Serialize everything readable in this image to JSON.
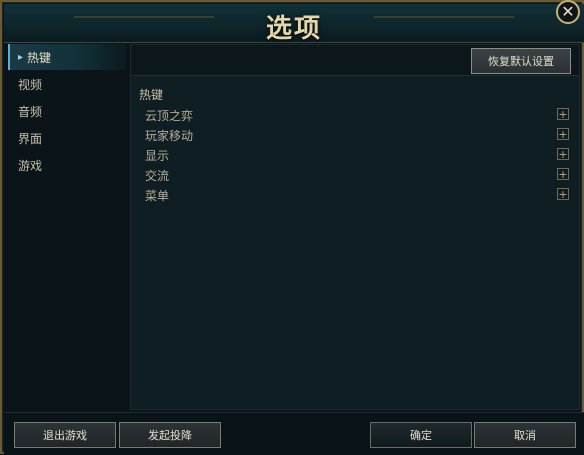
{
  "window": {
    "title": "选项",
    "close_glyph": "✕"
  },
  "sidebar": {
    "items": [
      {
        "label": "热键",
        "active": true
      },
      {
        "label": "视频",
        "active": false
      },
      {
        "label": "音频",
        "active": false
      },
      {
        "label": "界面",
        "active": false
      },
      {
        "label": "游戏",
        "active": false
      }
    ]
  },
  "main": {
    "reset_label": "恢复默认设置",
    "section_title": "热键",
    "rows": [
      {
        "label": "云顶之弈"
      },
      {
        "label": "玩家移动"
      },
      {
        "label": "显示"
      },
      {
        "label": "交流"
      },
      {
        "label": "菜单"
      }
    ],
    "expand_glyph": "+"
  },
  "footer": {
    "exit_label": "退出游戏",
    "surrender_label": "发起投降",
    "ok_label": "确定",
    "cancel_label": "取消"
  },
  "icons": {
    "close": "close-icon",
    "expand": "plus-icon",
    "active_marker": "caret-right-icon"
  },
  "colors": {
    "accent": "#5ab3cf",
    "gold": "#c7b27a",
    "title_text": "#e6d7a8",
    "panel_bg": "#0f1e22"
  }
}
